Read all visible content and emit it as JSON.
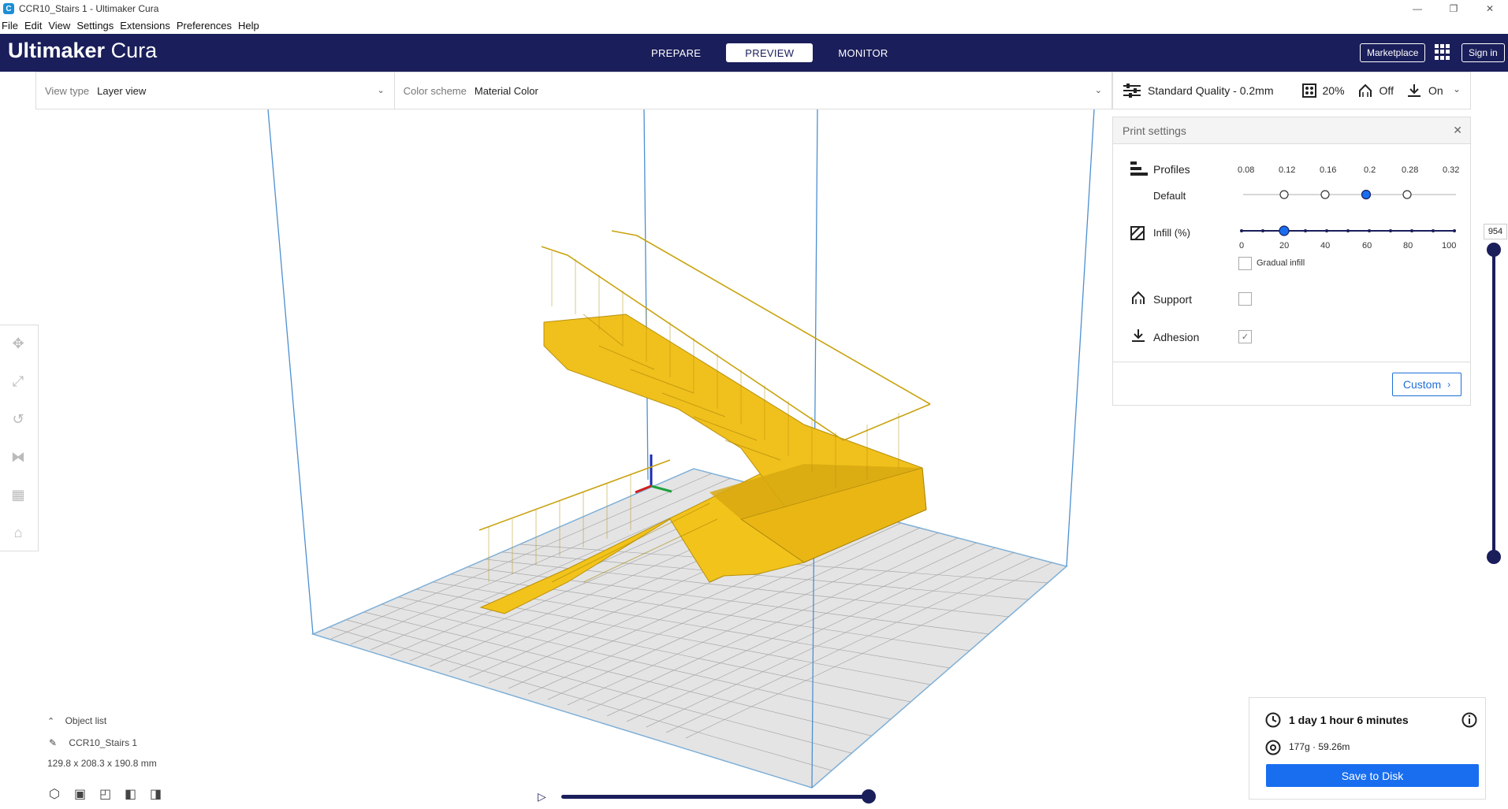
{
  "window": {
    "title": "CCR10_Stairs 1 - Ultimaker Cura",
    "controls": [
      "—",
      "❐",
      "✕"
    ]
  },
  "menu": [
    "File",
    "Edit",
    "View",
    "Settings",
    "Extensions",
    "Preferences",
    "Help"
  ],
  "header": {
    "logo_bold": "Ultimaker",
    "logo_light": "Cura",
    "tabs": [
      "PREPARE",
      "PREVIEW",
      "MONITOR"
    ],
    "active_tab": "PREVIEW",
    "marketplace": "Marketplace",
    "sign_in": "Sign in"
  },
  "view_bar": {
    "view_type_label": "View type",
    "view_type_value": "Layer view",
    "color_scheme_label": "Color scheme",
    "color_scheme_value": "Material Color"
  },
  "quality_bar": {
    "profile": "Standard Quality - 0.2mm",
    "infill": "20%",
    "support": "Off",
    "adhesion": "On"
  },
  "print_settings": {
    "title": "Print settings",
    "profiles_label": "Profiles",
    "default_label": "Default",
    "profile_values": [
      "0.08",
      "0.12",
      "0.16",
      "0.2",
      "0.28",
      "0.32"
    ],
    "selected_profile": "0.2",
    "infill_label": "Infill (%)",
    "infill_ticks": [
      "0",
      "20",
      "40",
      "60",
      "80",
      "100"
    ],
    "infill_value": 20,
    "gradual_infill_label": "Gradual infill",
    "gradual_infill_checked": false,
    "support_label": "Support",
    "support_checked": false,
    "adhesion_label": "Adhesion",
    "adhesion_checked": true,
    "custom_button": "Custom"
  },
  "layer_slider": {
    "value": "954"
  },
  "object_list": {
    "toggle_label": "Object list",
    "object_name": "CCR10_Stairs 1",
    "dimensions": "129.8 x 208.3 x 190.8 mm"
  },
  "print_info": {
    "time": "1 day 1 hour 6 minutes",
    "material": "177g · 59.26m",
    "save_button": "Save to Disk"
  },
  "colors": {
    "header_bg": "#1a1e5a",
    "accent_blue": "#196ef0",
    "model_yellow": "#f2c31a",
    "build_plate": "#d9d9d9"
  }
}
